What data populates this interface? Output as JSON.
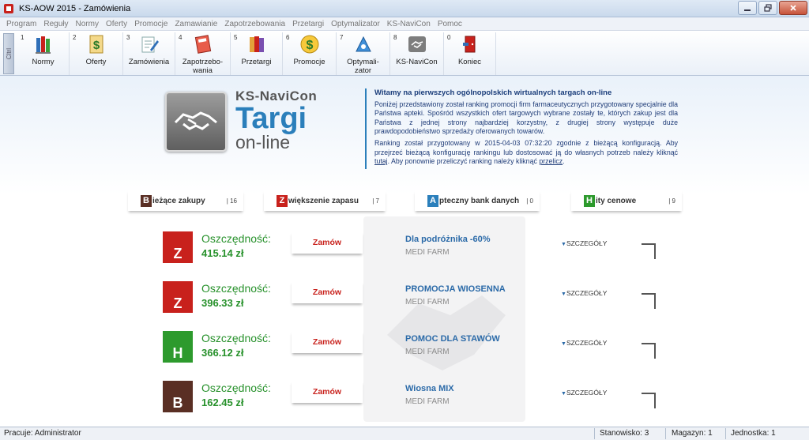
{
  "window": {
    "title": "KS-AOW 2015 - Zamówienia"
  },
  "menu": [
    "Program",
    "Reguły",
    "Normy",
    "Oferty",
    "Promocje",
    "Zamawianie",
    "Zapotrzebowania",
    "Przetargi",
    "Optymalizator",
    "KS-NaviCon",
    "Pomoc"
  ],
  "sidebar_tab": "Cltrl",
  "toolbar": [
    {
      "num": "1",
      "label": "Normy",
      "icon": "books-icon"
    },
    {
      "num": "2",
      "label": "Oferty",
      "icon": "dollar-document-icon"
    },
    {
      "num": "3",
      "label": "Zamówienia",
      "icon": "pen-document-icon"
    },
    {
      "num": "4",
      "label": "Zapotrzebo-\nwania",
      "icon": "notebook-icon"
    },
    {
      "num": "5",
      "label": "Przetargi",
      "icon": "binders-icon"
    },
    {
      "num": "6",
      "label": "Promocje",
      "icon": "dollar-sign-icon"
    },
    {
      "num": "7",
      "label": "Optymali-\nzator",
      "icon": "optimizer-icon"
    },
    {
      "num": "8",
      "label": "KS-NaviCon",
      "icon": "handshake-icon"
    },
    {
      "num": "0",
      "label": "Koniec",
      "icon": "exit-door-icon"
    }
  ],
  "brand": {
    "line1": "KS-NaviCon",
    "line2": "Targi",
    "line3": "on-line"
  },
  "intro": {
    "title": "Witamy na pierwszych ogólnopolskich wirtualnych targach on-line",
    "para1": "Poniżej przedstawiony został ranking promocji firm farmaceutycznych przygotowany specjalnie dla Państwa apteki. Spośród wszystkich ofert targowych wybrane zostały te, których zakup jest dla Państwa z jednej strony najbardziej korzystny, z drugiej strony występuje duże prawdopodobieństwo sprzedaży oferowanych towarów.",
    "para2_a": "Ranking został przygotowany w 2015-04-03 07:32:20 zgodnie z bieżącą konfiguracją. Aby przejrzeć bieżącą konfigurację rankingu lub dostosować ją do własnych potrzeb należy kliknąć ",
    "link1": "tutaj",
    "para2_b": ". Aby ponownie przeliczyć ranking należy kliknąć ",
    "link2": "przelicz",
    "para2_c": "."
  },
  "categories": [
    {
      "letter": "B",
      "text": "ieżące zakupy",
      "count": "| 16",
      "color": "#5a2f24"
    },
    {
      "letter": "Z",
      "text": "większenie zapasu",
      "count": "| 7",
      "color": "#c8211c"
    },
    {
      "letter": "A",
      "text": "pteczny bank danych",
      "count": "| 0",
      "color": "#2b7fbb"
    },
    {
      "letter": "H",
      "text": "ity cenowe",
      "count": "| 9",
      "color": "#2d9a2d"
    }
  ],
  "offers": [
    {
      "letter": "Z",
      "color": "#c8211c",
      "savings_label": "Oszczędność:",
      "savings": "415.14 zł",
      "button": "Zamów",
      "name": "Dla podróżnika -60%",
      "firm": "MEDI FARM",
      "details": "SZCZEGÓŁY"
    },
    {
      "letter": "Z",
      "color": "#c8211c",
      "savings_label": "Oszczędność:",
      "savings": "396.33 zł",
      "button": "Zamów",
      "name": "PROMOCJA WIOSENNA",
      "firm": "MEDI FARM",
      "details": "SZCZEGÓŁY"
    },
    {
      "letter": "H",
      "color": "#2d9a2d",
      "savings_label": "Oszczędność:",
      "savings": "366.12 zł",
      "button": "Zamów",
      "name": "POMOC DLA STAWÓW",
      "firm": "MEDI FARM",
      "details": "SZCZEGÓŁY"
    },
    {
      "letter": "B",
      "color": "#5a2f24",
      "savings_label": "Oszczędność:",
      "savings": "162.45 zł",
      "button": "Zamów",
      "name": "Wiosna MIX",
      "firm": "MEDI FARM",
      "details": "SZCZEGÓŁY"
    }
  ],
  "status": {
    "user": "Pracuje: Administrator",
    "station": "Stanowisko: 3",
    "warehouse": "Magazyn: 1",
    "unit": "Jednostka: 1"
  }
}
